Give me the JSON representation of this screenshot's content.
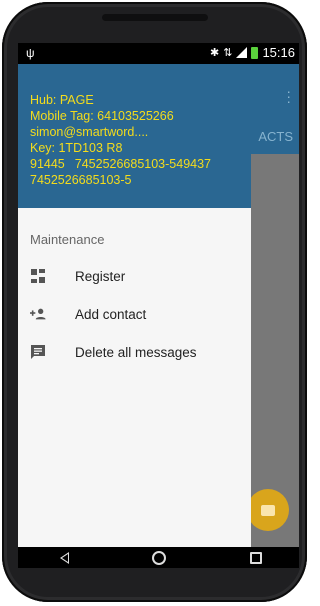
{
  "status_bar": {
    "time": "15:16"
  },
  "background_app": {
    "tab_label": "ACTS"
  },
  "drawer": {
    "header_lines": [
      "Hub: PAGE",
      "Mobile Tag: 64103525266",
      "simon@smartword....",
      "Key: 1TD103 R8",
      "914457452526685103-549437",
      "7452526685103-5"
    ],
    "section_label": "Maintenance",
    "items": [
      {
        "label": "Register",
        "icon": "dashboard-icon"
      },
      {
        "label": "Add contact",
        "icon": "add-person-icon"
      },
      {
        "label": "Delete all messages",
        "icon": "message-icon"
      }
    ]
  },
  "colors": {
    "header_bg": "#2a6792",
    "header_text": "#f4dc1c",
    "fab": "#d9a51c"
  }
}
